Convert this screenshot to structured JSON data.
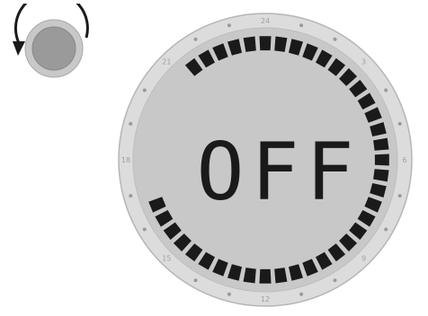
{
  "display": {
    "status_text": "OFF",
    "segment_count": 48,
    "lit_segments": 39,
    "tick_dots": 24,
    "hour_labels": [
      "24",
      "3",
      "6",
      "9",
      "12",
      "15",
      "18",
      "21"
    ]
  },
  "knob": {
    "icon": "rotate-counterclockwise-icon"
  },
  "colors": {
    "segment_lit": "#1a1a1a",
    "lcd_face": "#c8c8c8",
    "bezel": "#dcdcdc",
    "knob_face": "#9a9a9a"
  }
}
